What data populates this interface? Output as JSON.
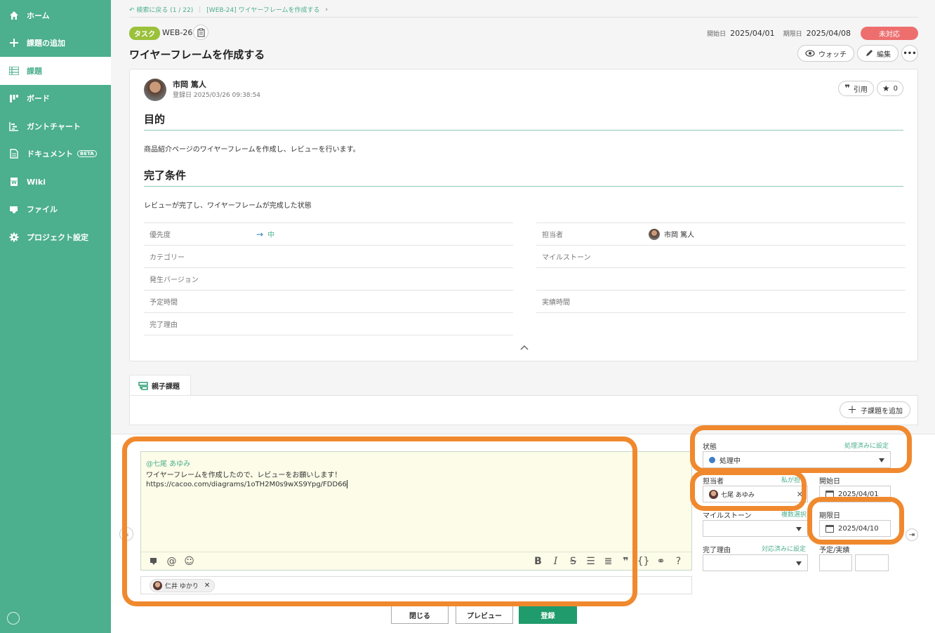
{
  "sidebar": {
    "items": [
      {
        "label": "ホーム",
        "icon": "home-icon"
      },
      {
        "label": "課題の追加",
        "icon": "plus-icon"
      },
      {
        "label": "課題",
        "icon": "list-icon"
      },
      {
        "label": "ボード",
        "icon": "board-icon"
      },
      {
        "label": "ガントチャート",
        "icon": "gantt-icon"
      },
      {
        "label": "ドキュメント",
        "icon": "document-icon",
        "badge": "BETA"
      },
      {
        "label": "Wiki",
        "icon": "wiki-icon"
      },
      {
        "label": "ファイル",
        "icon": "folder-icon"
      },
      {
        "label": "プロジェクト設定",
        "icon": "gear-icon"
      }
    ],
    "active_index": 2
  },
  "breadcrumb": {
    "back": "検索に戻る (1 / 22)",
    "parent": "[WEB-24] ワイヤーフレームを作成する"
  },
  "issue": {
    "type": "タスク",
    "key": "WEB-26",
    "title": "ワイヤーフレームを作成する",
    "start_label": "開始日",
    "start_date": "2025/04/01",
    "due_label": "期限日",
    "due_date": "2025/04/08",
    "status": "未対応"
  },
  "header_actions": {
    "watch": "ウォッチ",
    "edit": "編集"
  },
  "post": {
    "author": "市岡 篤人",
    "registered": "登録日 2025/03/26 09:38:54",
    "quote": "引用",
    "star_count": "0"
  },
  "description": {
    "h1": "目的",
    "p1": "商品紹介ページのワイヤーフレームを作成し、レビューを行います。",
    "h2": "完了条件",
    "p2": "レビューが完了し、ワイヤーフレームが完成した状態"
  },
  "properties": {
    "left": [
      {
        "label": "優先度",
        "value": "中"
      },
      {
        "label": "カテゴリー",
        "value": ""
      },
      {
        "label": "発生バージョン",
        "value": ""
      },
      {
        "label": "予定時間",
        "value": ""
      },
      {
        "label": "完了理由",
        "value": ""
      }
    ],
    "right": [
      {
        "label": "担当者",
        "value": "市岡 篤人"
      },
      {
        "label": "マイルストーン",
        "value": ""
      },
      {
        "label": "",
        "value": ""
      },
      {
        "label": "実績時間",
        "value": ""
      }
    ]
  },
  "parent_tab": {
    "label": "親子課題",
    "add_child": "子課題を追加"
  },
  "comment": {
    "mention": "@七尾 あゆみ",
    "line1": "ワイヤーフレームを作成したので、レビューをお願いします！",
    "line2": "https://cacoo.com/diagrams/1oTH2M0s9wXS9Ypg/FDD66",
    "notify_chip": "仁井 ゆかり"
  },
  "form": {
    "status_label": "状態",
    "status_link": "処理済みに設定",
    "status_value": "処理中",
    "assignee_label": "担当者",
    "assignee_link": "私が担",
    "assignee_value": "七尾 あゆみ",
    "start_label": "開始日",
    "start_value": "2025/04/01",
    "milestone_label": "マイルストーン",
    "milestone_link": "複数選択",
    "due_label": "期限日",
    "due_value": "2025/04/10",
    "reason_label": "完了理由",
    "reason_link": "対応済みに設定",
    "time_label": "予定/実績"
  },
  "buttons": {
    "close": "閉じる",
    "preview": "プレビュー",
    "submit": "登録"
  },
  "colors": {
    "brand": "#4caf8e",
    "highlight": "#f0892e",
    "status_badge": "#ee6e6e"
  }
}
